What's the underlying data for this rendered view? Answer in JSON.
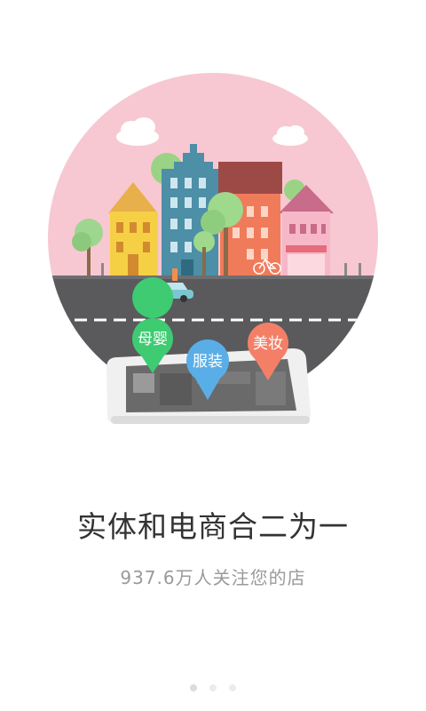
{
  "onboarding": {
    "headline": "实体和电商合二为一",
    "subline": "937.6万人关注您的店",
    "page_index": 1,
    "page_count": 3
  },
  "illustration": {
    "pins": [
      {
        "label": "母婴",
        "color": "#3ecb72"
      },
      {
        "label": "服装",
        "color": "#5aaee8"
      },
      {
        "label": "美妆",
        "color": "#f47f67"
      }
    ],
    "sky_color": "#f7c8d2",
    "road_color": "#5a5a5c"
  }
}
